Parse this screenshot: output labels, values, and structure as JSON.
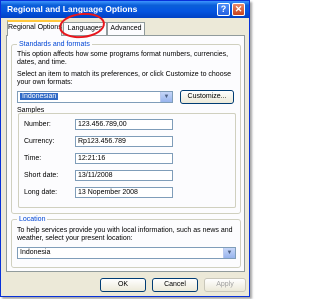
{
  "window": {
    "title": "Regional and Language Options",
    "help_glyph": "?",
    "close_glyph": "✕"
  },
  "tabs": {
    "regional": "Regional Options",
    "languages": "Languages",
    "advanced": "Advanced"
  },
  "standards": {
    "legend": "Standards and formats",
    "description": "This option affects how some programs format numbers, currencies, dates, and time.",
    "select_prompt": "Select an item to match its preferences, or click Customize to choose your own formats:",
    "format_value": "Indonesian",
    "customize_label": "Customize...",
    "samples_label": "Samples",
    "samples": [
      {
        "label": "Number:",
        "value": "123.456.789,00"
      },
      {
        "label": "Currency:",
        "value": "Rp123.456.789"
      },
      {
        "label": "Time:",
        "value": "12:21:16"
      },
      {
        "label": "Short date:",
        "value": "13/11/2008"
      },
      {
        "label": "Long date:",
        "value": "13 Nopember 2008"
      }
    ]
  },
  "location": {
    "legend": "Location",
    "description": "To help services provide you with local information, such as news and weather, select your present location:",
    "value": "Indonesia"
  },
  "buttons": {
    "ok": "OK",
    "cancel": "Cancel",
    "apply": "Apply"
  },
  "annotation_color": "#e8161c"
}
